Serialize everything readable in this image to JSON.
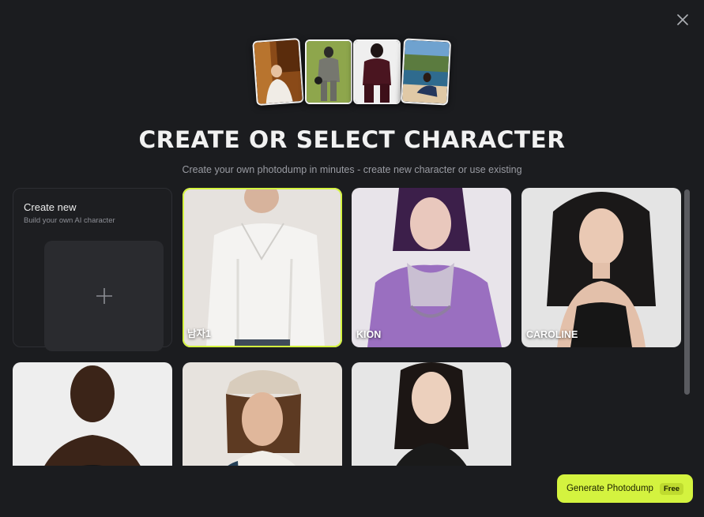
{
  "header": {
    "title": "CREATE OR SELECT CHARACTER",
    "subtitle": "Create your own photodump in minutes - create new character or use existing"
  },
  "hero_photos": [
    {
      "description": "person seated by window"
    },
    {
      "description": "person in grey suit on green background"
    },
    {
      "description": "person in dark suit"
    },
    {
      "description": "person on boat by the sea"
    }
  ],
  "create_card": {
    "title": "Create new",
    "subtitle": "Build your own AI character"
  },
  "characters": [
    {
      "label": "남자1",
      "selected": true
    },
    {
      "label": "KION",
      "selected": false
    },
    {
      "label": "CAROLINE",
      "selected": false
    },
    {
      "label": "",
      "selected": false
    },
    {
      "label": "",
      "selected": false
    },
    {
      "label": "",
      "selected": false
    }
  ],
  "footer": {
    "generate_label": "Generate Photodump",
    "badge": "Free"
  },
  "colors": {
    "accent": "#d4f33f",
    "background": "#1b1c1f"
  },
  "icons": [
    "close-icon",
    "plus-icon"
  ]
}
